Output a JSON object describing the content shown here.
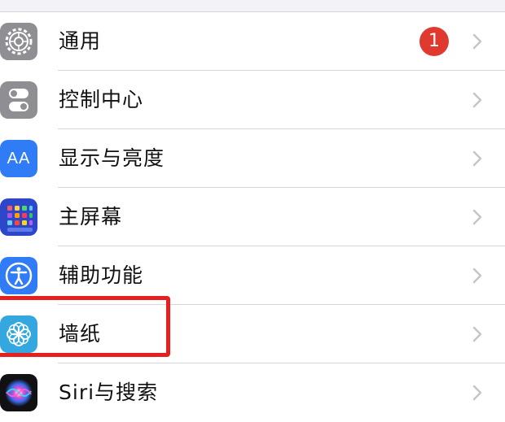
{
  "settings": {
    "items": [
      {
        "label": "通用",
        "icon": "gear-icon",
        "badge": "1"
      },
      {
        "label": "控制中心",
        "icon": "toggle-switches-icon"
      },
      {
        "label": "显示与亮度",
        "icon": "text-size-aa-icon",
        "icon_text": "AA"
      },
      {
        "label": "主屏幕",
        "icon": "app-grid-icon"
      },
      {
        "label": "辅助功能",
        "icon": "accessibility-person-icon"
      },
      {
        "label": "墙纸",
        "icon": "flower-wallpaper-icon"
      },
      {
        "label": "Siri与搜索",
        "icon": "siri-icon"
      }
    ]
  },
  "colors": {
    "background": "#f2f2f7",
    "list_background": "#ffffff",
    "separator": "#d6d6da",
    "badge": "#e0392f",
    "highlight": "#e6201f",
    "general_icon": "#8e8e93",
    "display_icon": "#2f7cf6",
    "homescreen_icon": "#2c47c9",
    "accessibility_icon": "#2f7cf6",
    "wallpaper_icon": "#35a7e0"
  }
}
